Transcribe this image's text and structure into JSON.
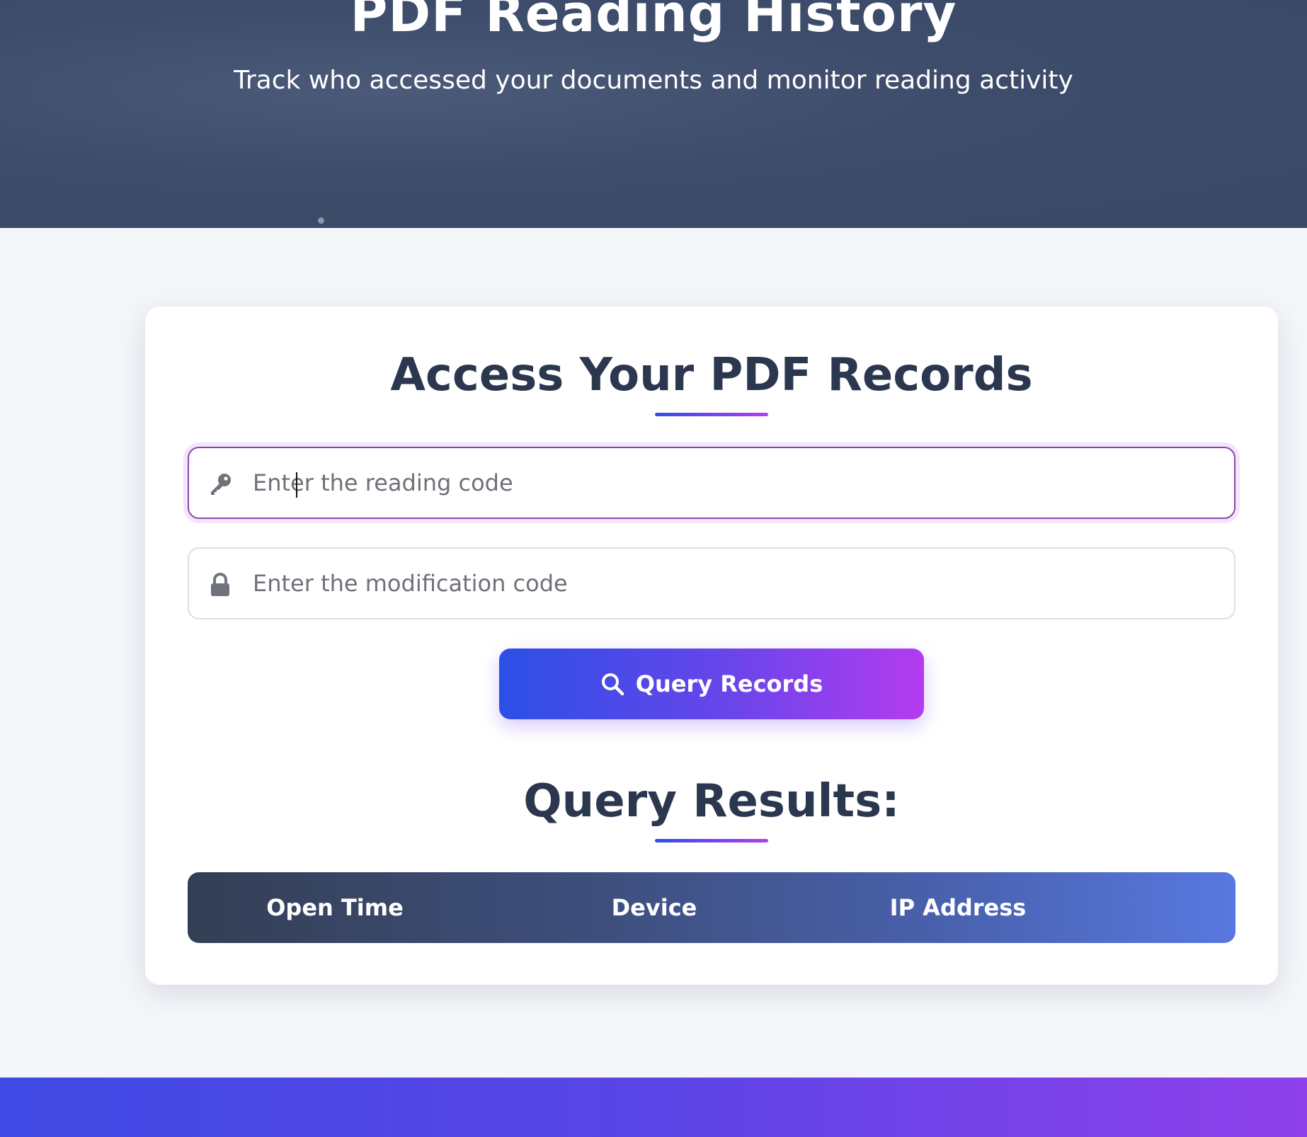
{
  "header": {
    "title": "PDF Reading History",
    "subtitle": "Track who accessed your documents and monitor reading activity"
  },
  "card": {
    "title": "Access Your PDF Records",
    "reading_code": {
      "placeholder": "Enter the reading code",
      "value": "",
      "icon": "key-icon"
    },
    "modification_code": {
      "placeholder": "Enter the modification code",
      "value": "",
      "icon": "lock-icon"
    },
    "query_button": {
      "label": "Query Records",
      "icon": "search-icon"
    },
    "results": {
      "title": "Query Results:",
      "columns": [
        "Open Time",
        "Device",
        "IP Address"
      ],
      "rows": []
    }
  },
  "colors": {
    "header_bg": "#3d4c6a",
    "page_bg": "#f4f6fa",
    "text_dark": "#2a374e",
    "accent_start": "#2b4fe6",
    "accent_end": "#b43cf0",
    "focus_border": "#8c46b3"
  }
}
